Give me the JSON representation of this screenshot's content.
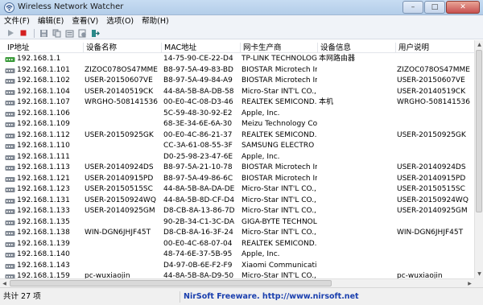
{
  "window": {
    "title": "Wireless Network Watcher",
    "minimize": "–",
    "maximize": "□",
    "close": "✕"
  },
  "menu": [
    "文件(F)",
    "编辑(E)",
    "查看(V)",
    "选项(O)",
    "帮助(H)"
  ],
  "toolbar_icons": [
    "play-icon",
    "stop-icon",
    "save-icon",
    "copy-icon",
    "properties-icon",
    "html-report-icon",
    "exit-icon"
  ],
  "columns": {
    "ip": "IP地址",
    "name": "设备名称",
    "mac": "MAC地址",
    "vendor": "网卡生产商",
    "device_info": "设备信息",
    "user_text": "用户说明"
  },
  "rows": [
    {
      "ip": "192.168.1.1",
      "name": "",
      "mac": "14-75-90-CE-22-D4",
      "vendor": "TP-LINK TECHNOLOG...",
      "device_info": "本网路由器",
      "user_text": "",
      "icon": "router"
    },
    {
      "ip": "192.168.1.101",
      "name": "ZIZOC078OS47MME",
      "mac": "B8-97-5A-49-83-BD",
      "vendor": "BIOSTAR Microtech In...",
      "device_info": "",
      "user_text": "ZIZOC078OS47MME",
      "icon": "device"
    },
    {
      "ip": "192.168.1.102",
      "name": "USER-20150607VE",
      "mac": "B8-97-5A-49-84-A9",
      "vendor": "BIOSTAR Microtech In...",
      "device_info": "",
      "user_text": "USER-20150607VE",
      "icon": "device"
    },
    {
      "ip": "192.168.1.104",
      "name": "USER-20140519CK",
      "mac": "44-8A-5B-8A-DB-58",
      "vendor": "Micro-Star INT'L CO., ...",
      "device_info": "",
      "user_text": "USER-20140519CK",
      "icon": "device"
    },
    {
      "ip": "192.168.1.107",
      "name": "WRGHO-508141536",
      "mac": "00-E0-4C-08-D3-46",
      "vendor": "REALTEK SEMICOND...",
      "device_info": "本机",
      "user_text": "WRGHO-508141536",
      "icon": "device"
    },
    {
      "ip": "192.168.1.106",
      "name": "",
      "mac": "5C-59-48-30-92-E2",
      "vendor": "Apple, Inc.",
      "device_info": "",
      "user_text": "",
      "icon": "device"
    },
    {
      "ip": "192.168.1.109",
      "name": "",
      "mac": "68-3E-34-6E-6A-30",
      "vendor": "Meizu Technology Co....",
      "device_info": "",
      "user_text": "",
      "icon": "device"
    },
    {
      "ip": "192.168.1.112",
      "name": "USER-20150925GK",
      "mac": "00-E0-4C-86-21-37",
      "vendor": "REALTEK SEMICOND...",
      "device_info": "",
      "user_text": "USER-20150925GK",
      "icon": "device"
    },
    {
      "ip": "192.168.1.110",
      "name": "",
      "mac": "CC-3A-61-08-55-3F",
      "vendor": "SAMSUNG ELECTRO ...",
      "device_info": "",
      "user_text": "",
      "icon": "device"
    },
    {
      "ip": "192.168.1.111",
      "name": "",
      "mac": "D0-25-98-23-47-6E",
      "vendor": "Apple, Inc.",
      "device_info": "",
      "user_text": "",
      "icon": "device"
    },
    {
      "ip": "192.168.1.113",
      "name": "USER-20140924DS",
      "mac": "B8-97-5A-21-10-78",
      "vendor": "BIOSTAR Microtech In...",
      "device_info": "",
      "user_text": "USER-20140924DS",
      "icon": "device"
    },
    {
      "ip": "192.168.1.121",
      "name": "USER-20140915PD",
      "mac": "B8-97-5A-49-86-6C",
      "vendor": "BIOSTAR Microtech In...",
      "device_info": "",
      "user_text": "USER-20140915PD",
      "icon": "device"
    },
    {
      "ip": "192.168.1.123",
      "name": "USER-20150515SC",
      "mac": "44-8A-5B-8A-DA-DE",
      "vendor": "Micro-Star INT'L CO., ...",
      "device_info": "",
      "user_text": "USER-20150515SC",
      "icon": "device"
    },
    {
      "ip": "192.168.1.131",
      "name": "USER-20150924WQ",
      "mac": "44-8A-5B-8D-CF-D4",
      "vendor": "Micro-Star INT'L CO., ...",
      "device_info": "",
      "user_text": "USER-20150924WQ",
      "icon": "device"
    },
    {
      "ip": "192.168.1.133",
      "name": "USER-20140925GM",
      "mac": "D8-CB-8A-13-86-7D",
      "vendor": "Micro-Star INT'L CO., ...",
      "device_info": "",
      "user_text": "USER-20140925GM",
      "icon": "device"
    },
    {
      "ip": "192.168.1.135",
      "name": "",
      "mac": "90-2B-34-C1-3C-DA",
      "vendor": "GIGA-BYTE TECHNOL...",
      "device_info": "",
      "user_text": "",
      "icon": "device"
    },
    {
      "ip": "192.168.1.138",
      "name": "WIN-DGN6JHJF45T",
      "mac": "D8-CB-8A-16-3F-24",
      "vendor": "Micro-Star INT'L CO., ...",
      "device_info": "",
      "user_text": "WIN-DGN6JHJF45T",
      "icon": "device"
    },
    {
      "ip": "192.168.1.139",
      "name": "",
      "mac": "00-E0-4C-68-07-04",
      "vendor": "REALTEK SEMICOND...",
      "device_info": "",
      "user_text": "",
      "icon": "device"
    },
    {
      "ip": "192.168.1.140",
      "name": "",
      "mac": "48-74-6E-37-5B-95",
      "vendor": "Apple, Inc.",
      "device_info": "",
      "user_text": "",
      "icon": "device"
    },
    {
      "ip": "192.168.1.143",
      "name": "",
      "mac": "D4-97-0B-6E-F2-F9",
      "vendor": "Xiaomi Communicatio...",
      "device_info": "",
      "user_text": "",
      "icon": "device"
    },
    {
      "ip": "192.168.1.159",
      "name": "pc-wuxiaojin",
      "mac": "44-8A-5B-8A-D9-50",
      "vendor": "Micro-Star INT'L CO., ...",
      "device_info": "",
      "user_text": "pc-wuxiaojin",
      "icon": "device"
    }
  ],
  "status": {
    "count": "共计 27 项",
    "link": "NirSoft Freeware.  http://www.nirsoft.net"
  },
  "colors": {
    "router_icon": "#3a9a3a",
    "device_icon": "#7d8590",
    "link": "#1a3fae"
  }
}
